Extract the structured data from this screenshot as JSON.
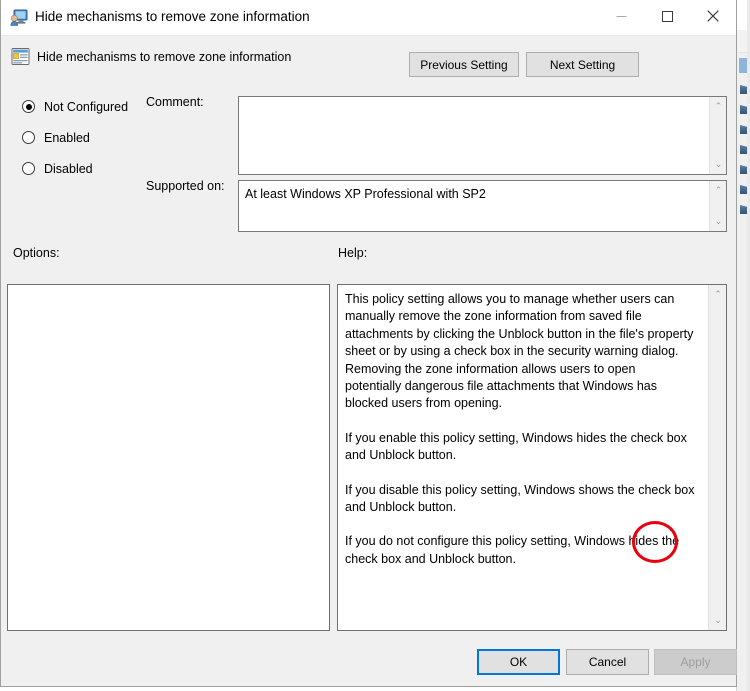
{
  "window": {
    "title": "Hide mechanisms to remove zone information",
    "icon": "policy-computer-icon",
    "controls": {
      "minimize": "minimize-icon",
      "maximize": "maximize-icon",
      "close": "close-icon"
    }
  },
  "header": {
    "icon": "group-policy-setting-icon",
    "setting_name": "Hide mechanisms to remove zone information",
    "previous_setting": "Previous Setting",
    "next_setting": "Next Setting"
  },
  "state": {
    "options": [
      {
        "label": "Not Configured",
        "selected": true
      },
      {
        "label": "Enabled",
        "selected": false
      },
      {
        "label": "Disabled",
        "selected": false
      }
    ]
  },
  "comment": {
    "label": "Comment:",
    "value": "",
    "placeholder": ""
  },
  "supported_on": {
    "label": "Supported on:",
    "value": "At least Windows XP Professional with SP2"
  },
  "sections": {
    "options_label": "Options:",
    "help_label": "Help:"
  },
  "options_panel": {
    "content": ""
  },
  "help": {
    "paragraphs": [
      "This policy setting allows you to manage whether users can manually remove the zone information from saved file attachments by clicking the Unblock button in the file's property sheet or by using a check box in the security warning dialog. Removing the zone information allows users to open potentially dangerous file attachments that Windows has blocked users from opening.",
      "If you enable this policy setting, Windows hides the check box and Unblock button.",
      "If you disable this policy setting, Windows shows the check box and Unblock button.",
      "If you do not configure this policy setting, Windows hides the check box and Unblock button."
    ]
  },
  "annotation": {
    "shape": "ellipse",
    "color": "#e8000d",
    "highlights_word": "hides"
  },
  "footer": {
    "ok": "OK",
    "cancel": "Cancel",
    "apply": "Apply",
    "apply_disabled": true,
    "ok_is_default": true
  },
  "colors": {
    "dialog_background": "#f0f0f0",
    "titlebar_background": "#ffffff",
    "accent_focus": "#0078d7",
    "annotation_red": "#e8000d",
    "field_background": "#ffffff"
  },
  "scrollbars": {
    "up_glyph": "⌃",
    "down_glyph": "⌄"
  }
}
